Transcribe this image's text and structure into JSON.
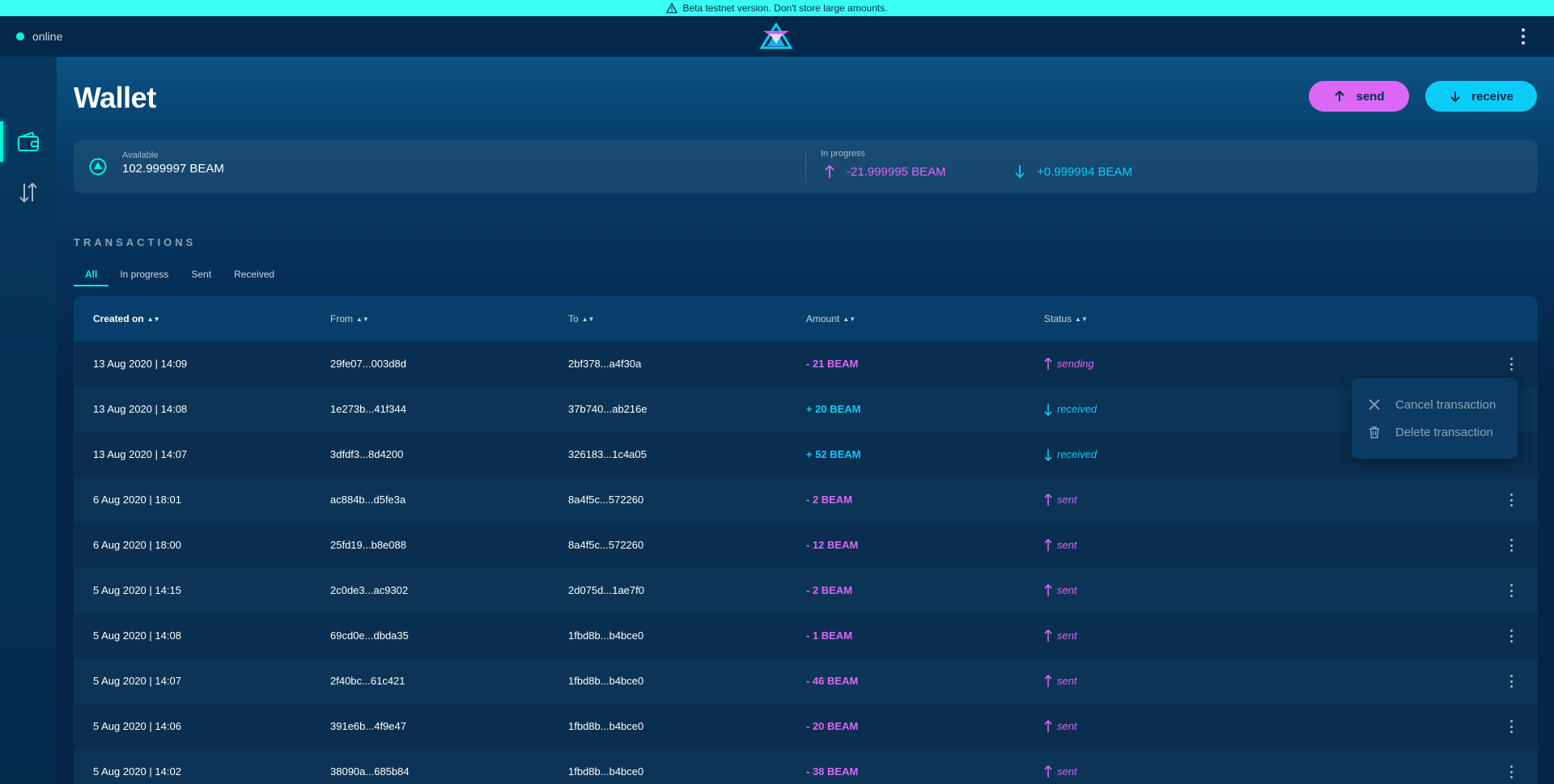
{
  "banner": {
    "text": "Beta testnet version. Don't store large amounts.",
    "icon": "warning-icon"
  },
  "topbar": {
    "status": "online",
    "status_color": "#00f6d2",
    "logo": "beam-logo",
    "menu_icon": "kebab-icon"
  },
  "sidebar": {
    "items": [
      {
        "name": "wallet",
        "icon": "wallet-icon",
        "active": true
      },
      {
        "name": "atomic-swap",
        "icon": "swap-arrows-icon",
        "active": false
      }
    ]
  },
  "page": {
    "title": "Wallet"
  },
  "actions": {
    "send_label": "send",
    "receive_label": "receive",
    "send_color": "#da68f5",
    "receive_color": "#0bccf7"
  },
  "balance": {
    "available_label": "Available",
    "available_value": "102.999997 BEAM",
    "in_progress_label": "In progress",
    "outgoing_value": "-21.999995 BEAM",
    "incoming_value": "+0.999994 BEAM"
  },
  "transactions": {
    "title": "TRANSACTIONS",
    "tabs": [
      "All",
      "In progress",
      "Sent",
      "Received"
    ],
    "active_tab": "All",
    "columns": [
      "Created on",
      "From",
      "To",
      "Amount",
      "Status"
    ],
    "sorted_column": "Created on",
    "rows": [
      {
        "date": "13 Aug 2020 | 14:09",
        "from": "29fe07...003d8d",
        "to": "2bf378...a4f30a",
        "amount": "- 21 BEAM",
        "status": "sending",
        "direction": "out"
      },
      {
        "date": "13 Aug 2020 | 14:08",
        "from": "1e273b...41f344",
        "to": "37b740...ab216e",
        "amount": "+ 20 BEAM",
        "status": "received",
        "direction": "in"
      },
      {
        "date": "13 Aug 2020 | 14:07",
        "from": "3dfdf3...8d4200",
        "to": "326183...1c4a05",
        "amount": "+ 52 BEAM",
        "status": "received",
        "direction": "in"
      },
      {
        "date": "6 Aug 2020 | 18:01",
        "from": "ac884b...d5fe3a",
        "to": "8a4f5c...572260",
        "amount": "- 2 BEAM",
        "status": "sent",
        "direction": "out"
      },
      {
        "date": "6 Aug 2020 | 18:00",
        "from": "25fd19...b8e088",
        "to": "8a4f5c...572260",
        "amount": "- 12 BEAM",
        "status": "sent",
        "direction": "out"
      },
      {
        "date": "5 Aug 2020 | 14:15",
        "from": "2c0de3...ac9302",
        "to": "2d075d...1ae7f0",
        "amount": "- 2 BEAM",
        "status": "sent",
        "direction": "out"
      },
      {
        "date": "5 Aug 2020 | 14:08",
        "from": "69cd0e...dbda35",
        "to": "1fbd8b...b4bce0",
        "amount": "- 1 BEAM",
        "status": "sent",
        "direction": "out"
      },
      {
        "date": "5 Aug 2020 | 14:07",
        "from": "2f40bc...61c421",
        "to": "1fbd8b...b4bce0",
        "amount": "- 46 BEAM",
        "status": "sent",
        "direction": "out"
      },
      {
        "date": "5 Aug 2020 | 14:06",
        "from": "391e6b...4f9e47",
        "to": "1fbd8b...b4bce0",
        "amount": "- 20 BEAM",
        "status": "sent",
        "direction": "out"
      },
      {
        "date": "5 Aug 2020 | 14:02",
        "from": "38090a...685b84",
        "to": "1fbd8b...b4bce0",
        "amount": "- 38 BEAM",
        "status": "sent",
        "direction": "out"
      }
    ]
  },
  "context_menu": {
    "items": [
      {
        "label": "Cancel transaction",
        "icon": "close-icon"
      },
      {
        "label": "Delete transaction",
        "icon": "trash-icon"
      }
    ]
  }
}
